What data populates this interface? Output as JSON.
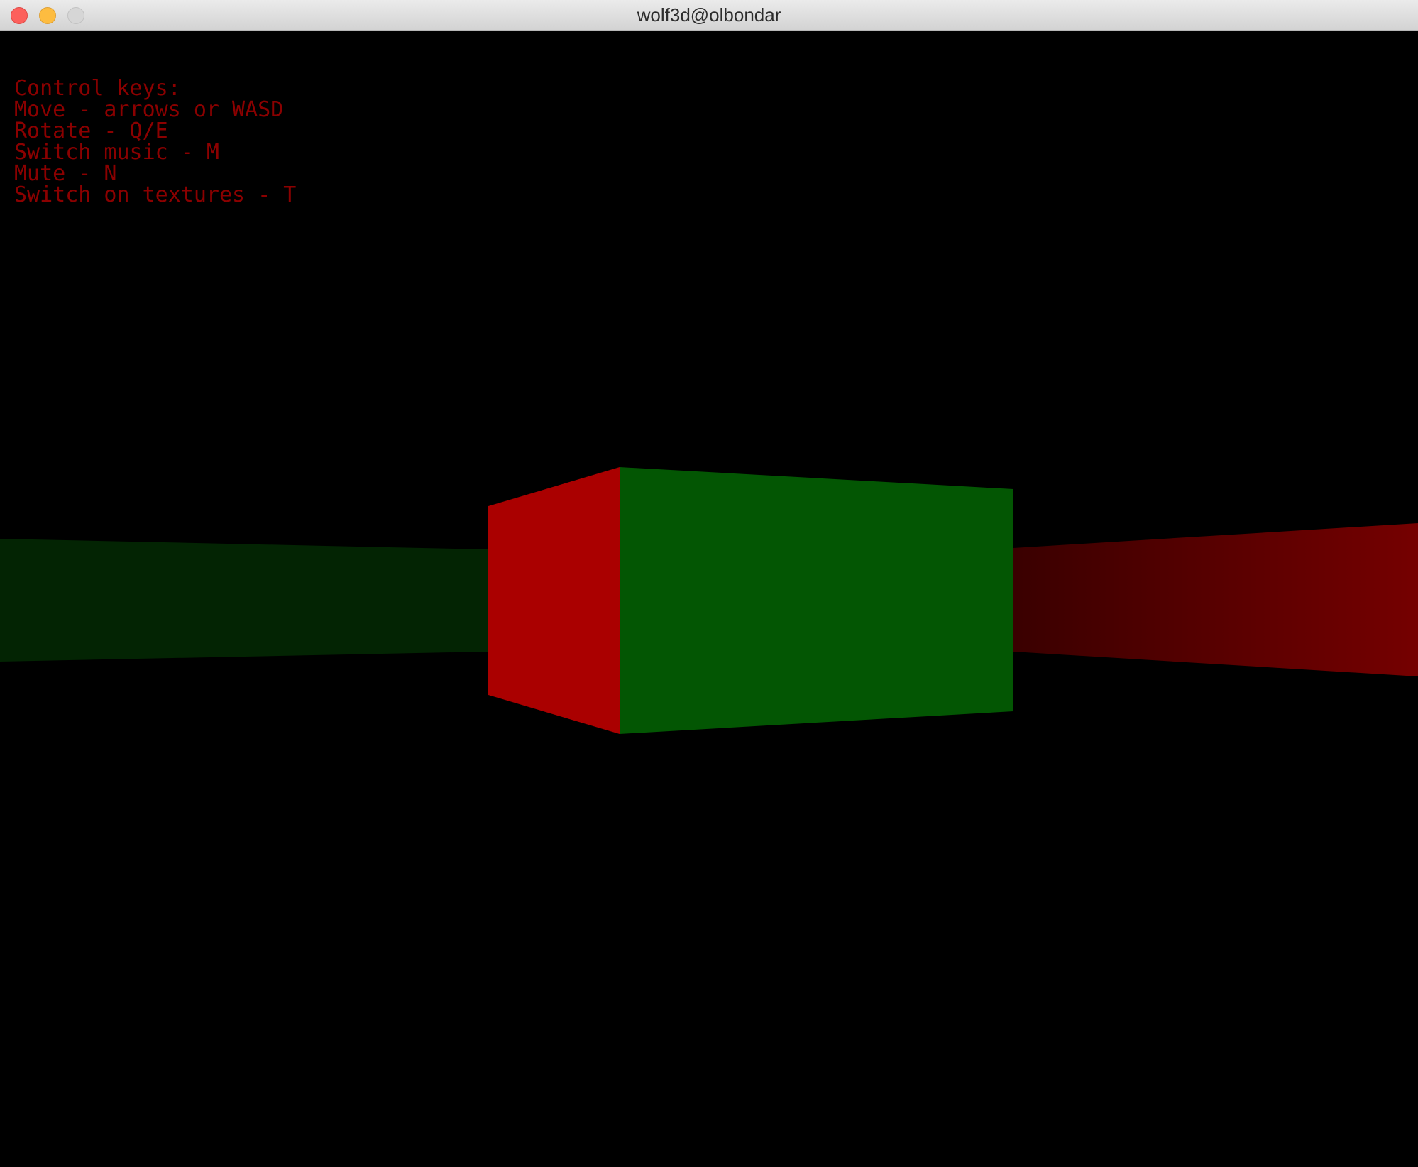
{
  "window": {
    "title": "wolf3d@olbondar"
  },
  "help": {
    "heading": "Control keys:",
    "lines": [
      "Move - arrows or WASD",
      "Rotate - Q/E",
      "Switch music - M",
      "Mute - N",
      "Switch on textures - T"
    ],
    "text_color": "#8b0000"
  },
  "scene": {
    "background_color": "#000000",
    "walls": [
      {
        "name": "left-wall-green",
        "color": "#032403"
      },
      {
        "name": "cube-front-red",
        "color": "#aa0000"
      },
      {
        "name": "cube-side-green",
        "color": "#035603"
      },
      {
        "name": "right-wall-red",
        "color_near": "#750000",
        "color_far": "#3a0000"
      }
    ]
  }
}
